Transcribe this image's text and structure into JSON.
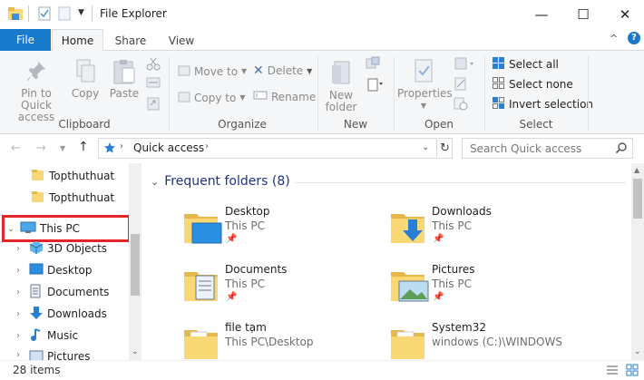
{
  "window": {
    "title": "File Explorer",
    "minimize": "—",
    "maximize": "☐",
    "close": "✕"
  },
  "tabs": {
    "file": "File",
    "home": "Home",
    "share": "Share",
    "view": "View"
  },
  "ribbon": {
    "clipboard": {
      "label": "Clipboard",
      "pin": "Pin to Quick access",
      "copy": "Copy",
      "paste": "Paste"
    },
    "organize": {
      "label": "Organize",
      "move_to": "Move to",
      "copy_to": "Copy to",
      "delete": "Delete",
      "rename": "Rename"
    },
    "new": {
      "label": "New",
      "new_folder": "New folder"
    },
    "open": {
      "label": "Open",
      "properties": "Properties"
    },
    "select": {
      "label": "Select",
      "select_all": "Select all",
      "select_none": "Select none",
      "invert_selection": "Invert selection"
    }
  },
  "address": {
    "path": "Quick access",
    "search_placeholder": "Search Quick access"
  },
  "nav": {
    "items": [
      {
        "label": "Topthuthuat",
        "icon": "folder-icon",
        "indent": 1
      },
      {
        "label": "Topthuthuat",
        "icon": "folder-icon",
        "indent": 1
      },
      {
        "label": "This PC",
        "icon": "computer-icon",
        "indent": 0,
        "expanded": true
      },
      {
        "label": "3D Objects",
        "icon": "cube-icon",
        "indent": 1
      },
      {
        "label": "Desktop",
        "icon": "desktop-icon",
        "indent": 1
      },
      {
        "label": "Documents",
        "icon": "document-icon",
        "indent": 1
      },
      {
        "label": "Downloads",
        "icon": "download-icon",
        "indent": 1
      },
      {
        "label": "Music",
        "icon": "music-icon",
        "indent": 1
      },
      {
        "label": "Pictures",
        "icon": "picture-icon",
        "indent": 1
      }
    ]
  },
  "content": {
    "section_title": "Frequent folders (8)",
    "folders": [
      {
        "name": "Desktop",
        "location": "This PC",
        "icon": "desktop-folder-icon"
      },
      {
        "name": "Downloads",
        "location": "This PC",
        "icon": "downloads-folder-icon"
      },
      {
        "name": "Documents",
        "location": "This PC",
        "icon": "documents-folder-icon"
      },
      {
        "name": "Pictures",
        "location": "This PC",
        "icon": "pictures-folder-icon"
      },
      {
        "name": "file tạm",
        "location": "This PC\\Desktop",
        "icon": "folder-icon"
      },
      {
        "name": "System32",
        "location": "windows (C:)\\WINDOWS",
        "icon": "folder-icon"
      }
    ]
  },
  "status": {
    "item_count": "28 items"
  },
  "colors": {
    "accent": "#1979ca",
    "highlight": "#e2252b",
    "folder": "#f8d775",
    "section_title": "#1e3287"
  }
}
